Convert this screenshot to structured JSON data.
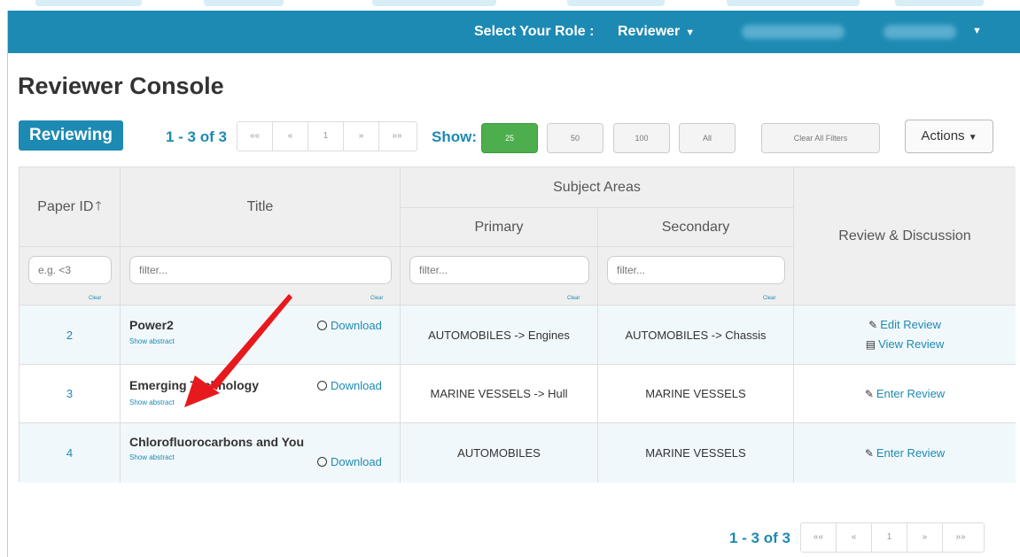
{
  "topbar": {
    "role_label": "Select Your Role :",
    "role_value": "Reviewer"
  },
  "page_title": "Reviewer Console",
  "badge": "Reviewing",
  "pager_top": {
    "count": "1 - 3 of 3",
    "first": "««",
    "prev": "«",
    "page": "1",
    "next": "»",
    "last": "»»"
  },
  "show": {
    "label": "Show:",
    "options": [
      "25",
      "50",
      "100",
      "All"
    ],
    "selected": "25"
  },
  "clear_filters_label": "Clear All Filters",
  "actions_label": "Actions",
  "columns": {
    "paper_id": "Paper ID",
    "title": "Title",
    "subject_areas": "Subject Areas",
    "primary": "Primary",
    "secondary": "Secondary",
    "review": "Review & Discussion"
  },
  "filters": {
    "paper_id_placeholder": "e.g. <3",
    "title_placeholder": "filter...",
    "primary_placeholder": "filter...",
    "secondary_placeholder": "filter...",
    "clear_label": "Clear"
  },
  "rows": [
    {
      "id": "2",
      "title": "Power2",
      "show_abstract": "Show abstract",
      "download": "Download",
      "primary": "AUTOMOBILES -> Engines",
      "secondary": "AUTOMOBILES -> Chassis",
      "actions": [
        "Edit Review",
        "View Review"
      ]
    },
    {
      "id": "3",
      "title": "Emerging Technology",
      "show_abstract": "Show abstract",
      "download": "Download",
      "primary": "MARINE VESSELS -> Hull",
      "secondary": "MARINE VESSELS",
      "actions": [
        "Enter Review"
      ]
    },
    {
      "id": "4",
      "title": "Chlorofluorocarbons and You",
      "show_abstract": "Show abstract",
      "download": "Download",
      "primary": "AUTOMOBILES",
      "secondary": "MARINE VESSELS",
      "actions": [
        "Enter Review"
      ]
    }
  ],
  "pager_bottom": {
    "count": "1 - 3 of 3",
    "first": "««",
    "prev": "«",
    "page": "1",
    "next": "»",
    "last": "»»"
  },
  "colors": {
    "brand": "#1d8ab3",
    "active_green": "#4cae4c",
    "annotation_arrow": "#e8191c"
  }
}
